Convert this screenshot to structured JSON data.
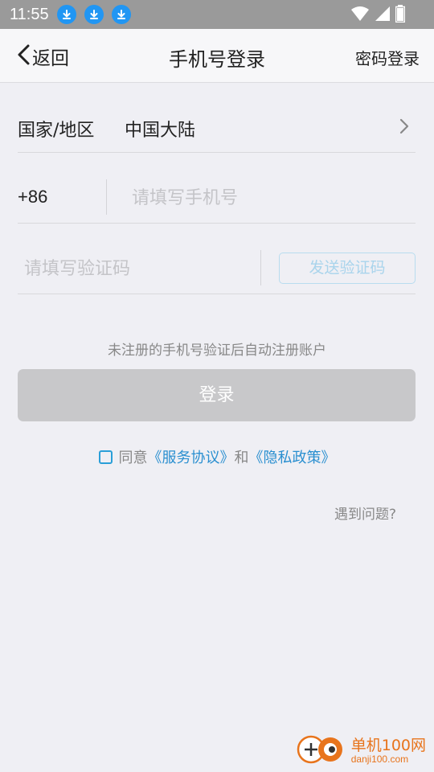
{
  "status_bar": {
    "time": "11:55",
    "icons": [
      "download-icon",
      "download-icon",
      "download-icon",
      "wifi-icon",
      "signal-icon",
      "battery-icon"
    ]
  },
  "header": {
    "back_label": "返回",
    "title": "手机号登录",
    "right_action": "密码登录"
  },
  "region": {
    "label": "国家/地区",
    "value": "中国大陆"
  },
  "phone": {
    "country_code": "+86",
    "placeholder": "请填写手机号",
    "value": ""
  },
  "code": {
    "placeholder": "请填写验证码",
    "value": "",
    "send_label": "发送验证码"
  },
  "hint": "未注册的手机号验证后自动注册账户",
  "login_label": "登录",
  "agreement": {
    "prefix": "同意",
    "service": "《服务协议》",
    "and": "和",
    "privacy": "《隐私政策》",
    "checked": false
  },
  "help_label": "遇到问题?",
  "watermark": {
    "cn": "单机100网",
    "en": "danji100.com"
  },
  "colors": {
    "accent": "#2a8fd0",
    "status_bar": "#9a9a9a",
    "login_disabled": "#c8c8ca",
    "watermark": "#e8741c"
  }
}
